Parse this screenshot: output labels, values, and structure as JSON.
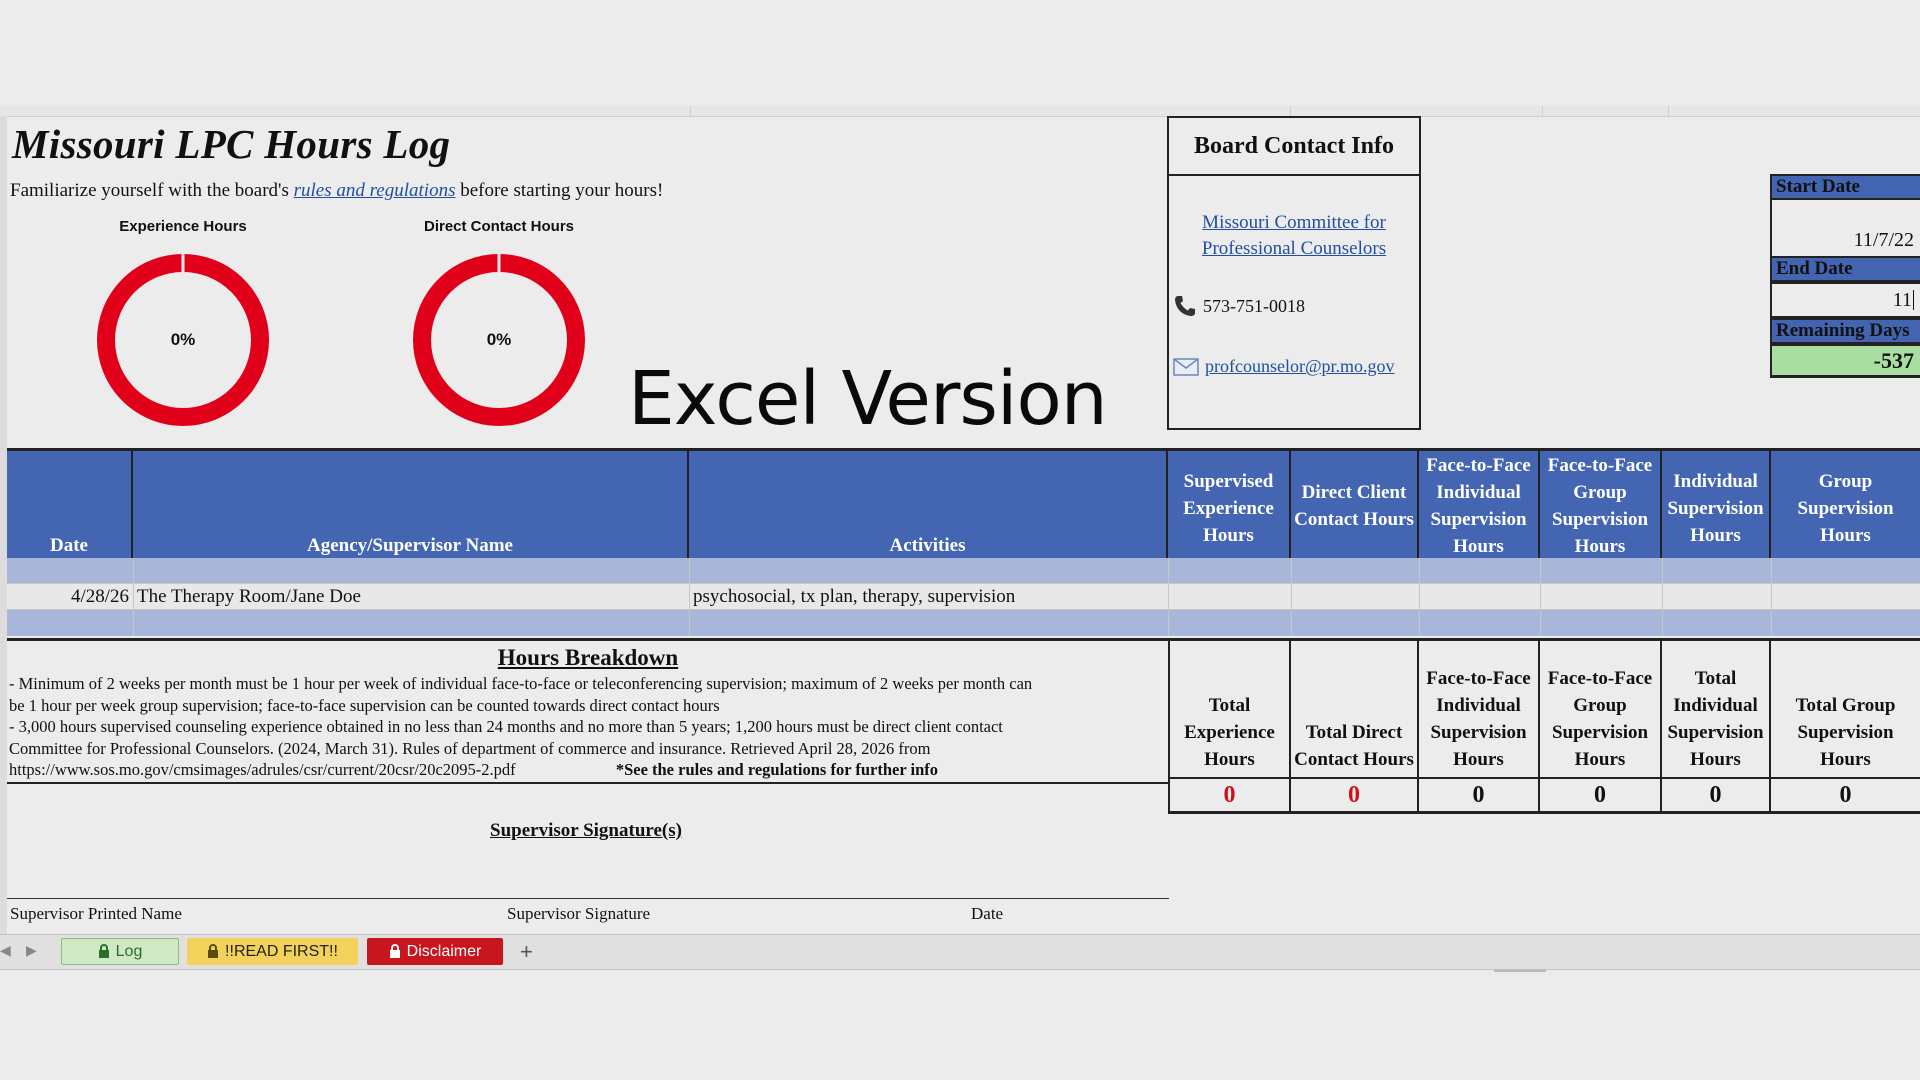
{
  "sheet": {
    "title": "Missouri LPC Hours Log",
    "intro_before": "Familiarize yourself with the board's",
    "intro_link": "rules and regulations",
    "intro_after": "before starting your hours!",
    "overlay_caption": "Excel Version"
  },
  "gauges": [
    {
      "label": "Experience Hours",
      "value": "0%",
      "fraction": 0,
      "ring_color": "#e0001a"
    },
    {
      "label": "Direct Contact Hours",
      "value": "0%",
      "fraction": 0,
      "ring_color": "#e0001a"
    }
  ],
  "contact": {
    "title": "Board Contact Info",
    "org_line1": "Missouri Committee for",
    "org_line2": "Professional Counselors",
    "phone_icon": "phone-icon",
    "phone": "573-751-0018",
    "email_icon": "mail-icon",
    "email": "profcounselor@pr.mo.gov"
  },
  "dates": {
    "start_label": "Start Date",
    "start_value": "11/7/22",
    "end_label": "End Date",
    "end_value": "11",
    "remaining_label": "Remaining Days",
    "remaining_value": "-537",
    "remaining_color": "#a9dda2"
  },
  "log_table": {
    "headers": [
      "Date",
      "Agency/Supervisor Name",
      "Activities",
      "Supervised Experience Hours",
      "Direct Client Contact Hours",
      "Face-to-Face Individual Supervision Hours",
      "Face-to-Face Group Supervision Hours",
      "Individual Supervision Hours",
      "Group Supervision Hours"
    ],
    "rows": [
      {
        "date": "4/28/26",
        "agency": "The Therapy Room/Jane Doe",
        "activities": "psychosocial, tx plan, therapy, supervision"
      }
    ]
  },
  "breakdown": {
    "title": "Hours Breakdown",
    "line1": "- Minimum of 2 weeks per month must be 1 hour per week of individual face-to-face or teleconferencing supervision; maximum of 2 weeks per month can",
    "line2": "be 1 hour per week group supervision; face-to-face supervision can be counted towards direct contact hours",
    "line3": "- 3,000 hours supervised counseling experience obtained in no less than 24 months and no more than 5 years; 1,200 hours must be direct client contact",
    "line4": "Committee for Professional Counselors. (2024, March 31). Rules of department of commerce and insurance. Retrieved April 28, 2026 from",
    "line5_url": "https://www.sos.mo.gov/cmsimages/adrules/csr/current/20csr/20c2095-2.pdf",
    "line5_note": "*See the rules and regulations for further info"
  },
  "totals": {
    "headers": [
      "Total Experience Hours",
      "Total Direct Contact Hours",
      "Face-to-Face Individual Supervision Hours",
      "Face-to-Face Group Supervision Hours",
      "Total Individual Supervision Hours",
      "Total Group Supervision Hours"
    ],
    "values": [
      "0",
      "0",
      "0",
      "0",
      "0",
      "0"
    ],
    "alert_color": "#d0101a"
  },
  "signature": {
    "title": "Supervisor Signature(s)",
    "printed_name": "Supervisor Printed Name",
    "signature": "Supervisor Signature",
    "date": "Date"
  },
  "tabs": [
    {
      "label": "Log",
      "icon": "lock-icon",
      "active": true
    },
    {
      "label": "!!READ FIRST!!",
      "icon": "lock-icon",
      "active": false
    },
    {
      "label": "Disclaimer",
      "icon": "lock-icon",
      "active": false
    }
  ],
  "add_sheet_label": "+",
  "colors": {
    "header_blue": "#4466b2",
    "row_shade": "#a7b6d9",
    "tab_log": "#cfe8c6",
    "tab_read_first": "#f2d25a",
    "tab_disclaimer": "#c8161f"
  }
}
